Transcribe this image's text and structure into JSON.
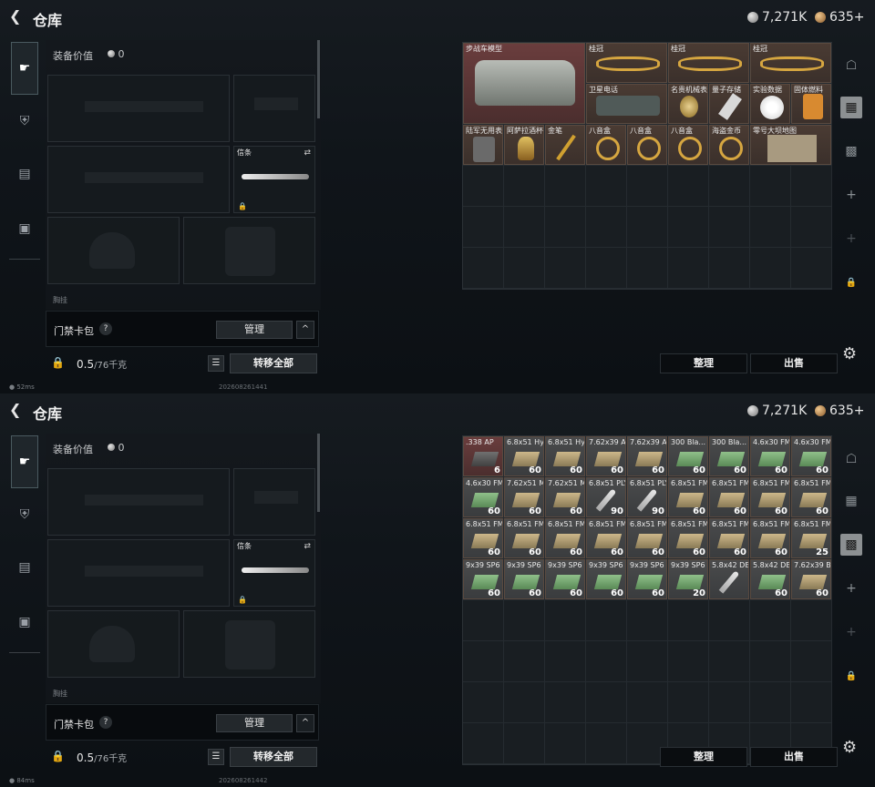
{
  "colors": {
    "accent": "#3fae8c",
    "red_rarity": "#6a3d3d",
    "gold_rarity": "#4a3b33"
  },
  "panels": [
    {
      "header": {
        "title": "仓库",
        "silver": "7,271K",
        "gold": "635+"
      },
      "equip": {
        "value_label": "装备价值",
        "value": "0",
        "knife_label": "信条",
        "cut_text": "胸挂"
      },
      "keycase": {
        "label": "门禁卡包",
        "qmark": "?",
        "manage": "管理",
        "up": "^"
      },
      "bottom": {
        "weight": "0.5",
        "cap": "/76千克",
        "transfer": "转移全部"
      },
      "status": {
        "ping": "52ms",
        "id": "202608261441"
      },
      "actions": {
        "sort": "整理",
        "sell": "出售"
      },
      "items": [
        {
          "name": "步战车模型",
          "count": ""
        },
        {
          "name": "桂冠",
          "count": ""
        },
        {
          "name": "桂冠",
          "count": ""
        },
        {
          "name": "桂冠",
          "count": ""
        },
        {
          "name": "卫星电话",
          "count": ""
        },
        {
          "name": "名贵机械表",
          "count": ""
        },
        {
          "name": "量子存储",
          "count": ""
        },
        {
          "name": "实验数据",
          "count": ""
        },
        {
          "name": "固体燃料",
          "count": ""
        },
        {
          "name": "陆军无用表",
          "count": ""
        },
        {
          "name": "阿萨拉酒杯",
          "count": ""
        },
        {
          "name": "金笔",
          "count": ""
        },
        {
          "name": "八音盒",
          "count": ""
        },
        {
          "name": "八音盒",
          "count": ""
        },
        {
          "name": "八音盒",
          "count": ""
        },
        {
          "name": "海盗金币",
          "count": ""
        },
        {
          "name": "零号大坝地图",
          "count": ""
        }
      ]
    },
    {
      "header": {
        "title": "仓库",
        "silver": "7,271K",
        "gold": "635+"
      },
      "equip": {
        "value_label": "装备价值",
        "value": "0",
        "knife_label": "信条",
        "cut_text": "胸挂"
      },
      "keycase": {
        "label": "门禁卡包",
        "qmark": "?",
        "manage": "管理",
        "up": "^"
      },
      "bottom": {
        "weight": "0.5",
        "cap": "/76千克",
        "transfer": "转移全部"
      },
      "status": {
        "ping": "84ms",
        "id": "202608261442"
      },
      "actions": {
        "sort": "整理",
        "sell": "出售"
      },
      "items": [
        {
          "name": ".338 AP",
          "count": "6"
        },
        {
          "name": "6.8x51 Hy...",
          "count": "60"
        },
        {
          "name": "6.8x51 Hy...",
          "count": "60"
        },
        {
          "name": "7.62x39 AP",
          "count": "60"
        },
        {
          "name": "7.62x39 AP",
          "count": "60"
        },
        {
          "name": "300 Bla... BCP FMJ",
          "count": "60"
        },
        {
          "name": "300 Bla... BCP FMJ",
          "count": "60"
        },
        {
          "name": "4.6x30 FMJ SX",
          "count": "60"
        },
        {
          "name": "4.6x30 FMJ SX",
          "count": "60"
        },
        {
          "name": "4.6x30 FMJ SX",
          "count": "60"
        },
        {
          "name": "7.62x51 M62",
          "count": "60"
        },
        {
          "name": "7.62x51 M62",
          "count": "60"
        },
        {
          "name": "6.8x51 PLY",
          "count": "90"
        },
        {
          "name": "6.8x51 PLY",
          "count": "90"
        },
        {
          "name": "6.8x51 FMJ",
          "count": "60"
        },
        {
          "name": "6.8x51 FMJ",
          "count": "60"
        },
        {
          "name": "6.8x51 FMJ",
          "count": "60"
        },
        {
          "name": "6.8x51 FMJ",
          "count": "60"
        },
        {
          "name": "6.8x51 FMJ",
          "count": "60"
        },
        {
          "name": "6.8x51 FMJ",
          "count": "60"
        },
        {
          "name": "6.8x51 FMJ",
          "count": "60"
        },
        {
          "name": "6.8x51 FMJ",
          "count": "60"
        },
        {
          "name": "6.8x51 FMJ",
          "count": "60"
        },
        {
          "name": "6.8x51 FMJ",
          "count": "60"
        },
        {
          "name": "6.8x51 FMJ",
          "count": "60"
        },
        {
          "name": "6.8x51 FMJ",
          "count": "60"
        },
        {
          "name": "6.8x51 FMJ",
          "count": "25"
        },
        {
          "name": "9x39 SP6",
          "count": "60"
        },
        {
          "name": "9x39 SP6",
          "count": "60"
        },
        {
          "name": "9x39 SP6",
          "count": "60"
        },
        {
          "name": "9x39 SP6",
          "count": "60"
        },
        {
          "name": "9x39 SP6",
          "count": "60"
        },
        {
          "name": "9x39 SP6",
          "count": "20"
        },
        {
          "name": "5.8x42 DBP10+P",
          "count": ""
        },
        {
          "name": "5.8x42 DBP10",
          "count": "60"
        },
        {
          "name": "7.62x39 BP",
          "count": "60"
        }
      ]
    }
  ]
}
